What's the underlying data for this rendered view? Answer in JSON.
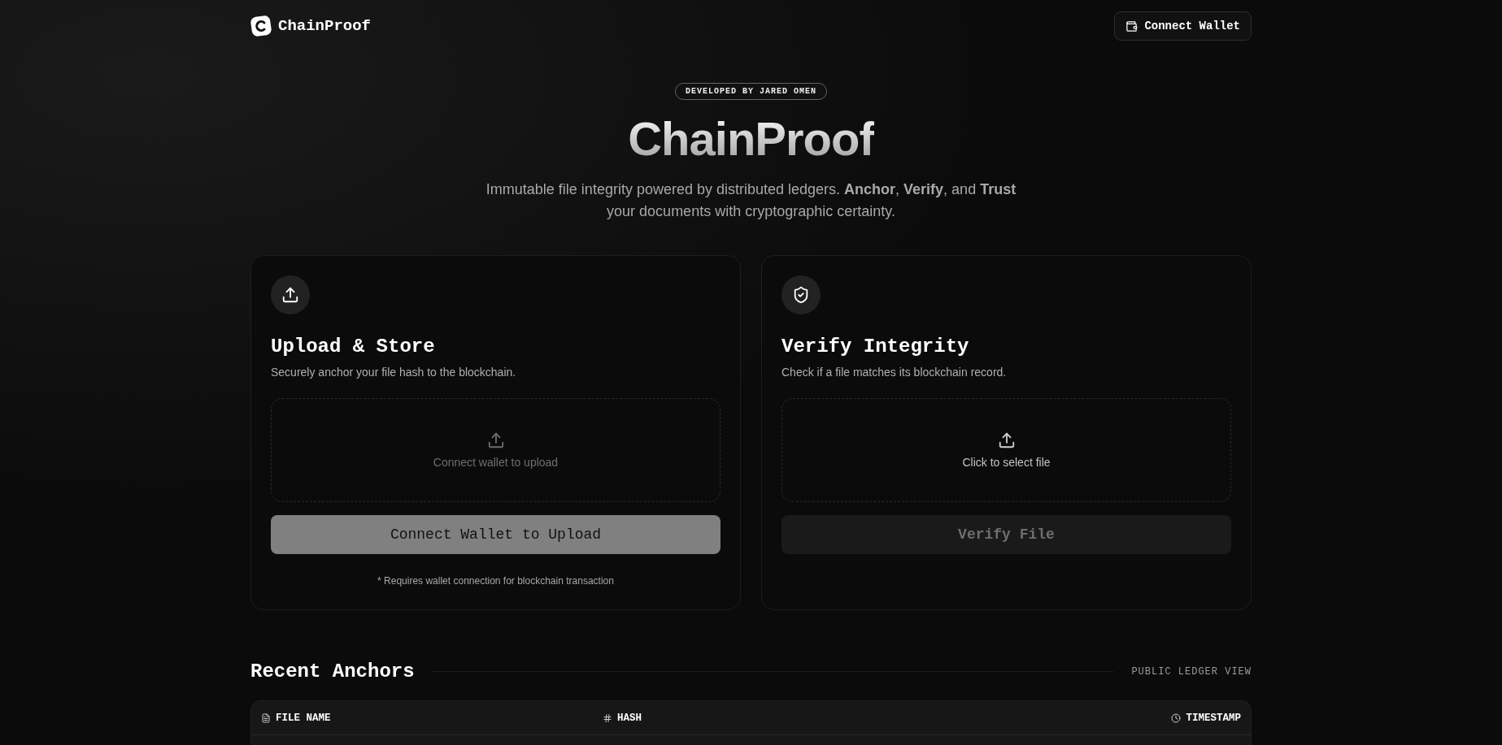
{
  "header": {
    "logo": "ChainProof",
    "connect_button": "Connect Wallet"
  },
  "hero": {
    "badge": "DEVELOPED BY JARED OMEN",
    "title": "ChainProof",
    "subtitle": "Immutable file integrity powered by distributed ledgers. **Anchor**, **Verify**, and **Trust** your documents with cryptographic certainty."
  },
  "cards": [
    {
      "kind": "upload",
      "title": "Upload & Store",
      "description": "Securely anchor your file hash to the blockchain.",
      "dropzone": {
        "label": "Connect wallet to upload",
        "disabled": true
      },
      "button": {
        "label": "Connect Wallet to Upload",
        "disabled": true
      },
      "footnote": "* Requires wallet connection for blockchain transaction"
    },
    {
      "kind": "verify",
      "title": "Verify Integrity",
      "description": "Check if a file matches its blockchain record.",
      "dropzone": {
        "label": "Click to select file",
        "disabled": false
      },
      "button": {
        "label": "Verify File",
        "disabled": true
      }
    }
  ],
  "recent": {
    "title": "Recent Anchors",
    "view_label": "PUBLIC LEDGER VIEW",
    "columns": [
      {
        "kind": "file",
        "label": "FILE NAME"
      },
      {
        "kind": "hash",
        "label": "HASH"
      },
      {
        "kind": "time",
        "label": "TIMESTAMP"
      }
    ]
  }
}
